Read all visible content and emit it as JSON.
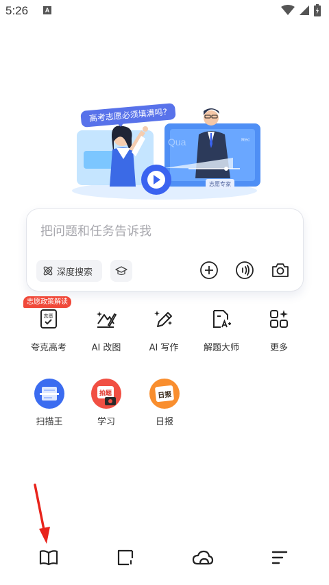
{
  "status_bar": {
    "time": "5:26",
    "notification_letter": "A"
  },
  "hero": {
    "bubble_text": "高考志愿必须填满吗?",
    "tag_text": "志愿专家",
    "screen_text": "Qua",
    "screen_rec": "Rec"
  },
  "input_card": {
    "placeholder": "把问题和任务告诉我",
    "deep_search_label": "深度搜索"
  },
  "tools": {
    "badge": "志愿政策解读",
    "items": [
      {
        "label": "夸克高考",
        "icon": "exam-doc-icon"
      },
      {
        "label": "AI 改图",
        "icon": "ai-edit-image-icon"
      },
      {
        "label": "AI 写作",
        "icon": "ai-write-icon"
      },
      {
        "label": "解题大师",
        "icon": "solve-doc-icon"
      },
      {
        "label": "更多",
        "icon": "grid-more-icon"
      }
    ]
  },
  "apps": {
    "items": [
      {
        "label": "扫描王",
        "icon": "scanner-icon"
      },
      {
        "label": "学习",
        "icon": "study-icon",
        "icon_text": "拍题"
      },
      {
        "label": "日报",
        "icon": "daily-icon",
        "icon_text": "日报"
      }
    ]
  },
  "bottom_nav": {
    "items": [
      "book-icon",
      "tabs-icon",
      "cloud-icon",
      "menu-icon"
    ]
  },
  "colors": {
    "brand_blue": "#3a63f0",
    "badge_red": "#f0493a",
    "arrow_red": "#e8241c"
  }
}
